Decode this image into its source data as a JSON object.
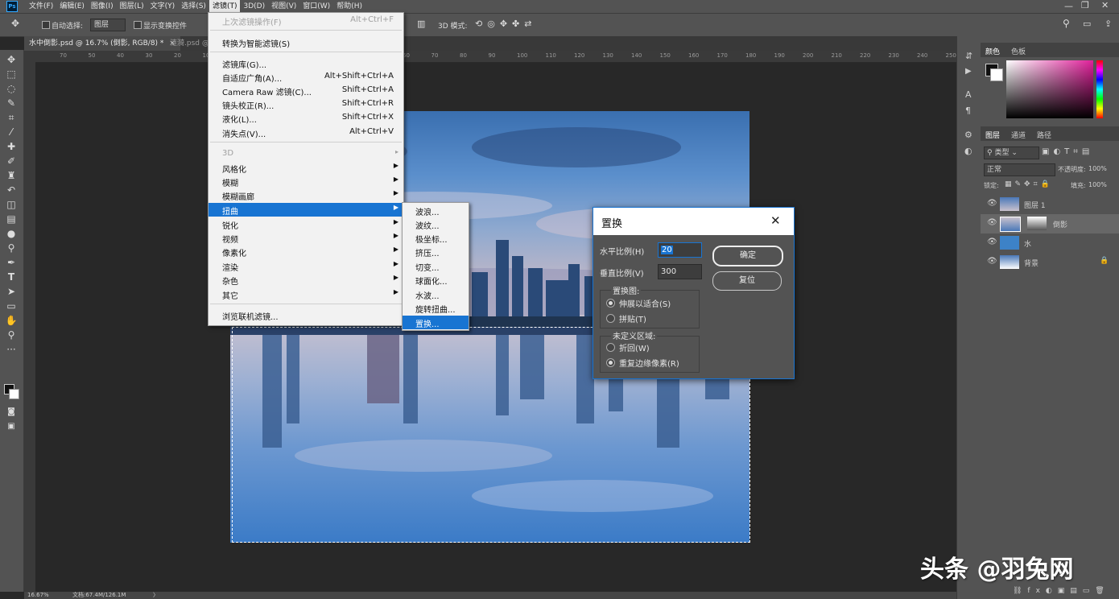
{
  "menubar": {
    "logo": "Ps",
    "items": [
      "文件(F)",
      "编辑(E)",
      "图像(I)",
      "图层(L)",
      "文字(Y)",
      "选择(S)",
      "滤镜(T)",
      "3D(D)",
      "视图(V)",
      "窗口(W)",
      "帮助(H)"
    ]
  },
  "options": {
    "auto_select": "自动选择:",
    "layer_select": "图层",
    "show_transform": "显示变换控件",
    "mode_3d": "3D 模式:"
  },
  "tabs": [
    {
      "label": "水中倒影.psd @ 16.7% (倒影, RGB/8) *",
      "close": "×"
    },
    {
      "label": "涟漪.psd @"
    }
  ],
  "ruler_ticks": [
    "70",
    "50",
    "40",
    "30",
    "20",
    "10",
    "0",
    "10",
    "20",
    "30",
    "40",
    "50",
    "60",
    "70",
    "80",
    "90",
    "100",
    "110",
    "120",
    "130",
    "140",
    "150",
    "160",
    "170",
    "180",
    "190",
    "200",
    "210",
    "220",
    "230",
    "240",
    "250"
  ],
  "status": {
    "zoom": "16.67%",
    "doc": "文档:67.4M/126.1M"
  },
  "filter_menu": {
    "items": [
      {
        "label": "上次滤镜操作(F)",
        "shortcut": "Alt+Ctrl+F",
        "disabled": true
      },
      {
        "label": "转换为智能滤镜(S)",
        "shortcut": ""
      },
      {
        "label": "滤镜库(G)...",
        "shortcut": ""
      },
      {
        "label": "自适应广角(A)...",
        "shortcut": "Alt+Shift+Ctrl+A"
      },
      {
        "label": "Camera Raw 滤镜(C)...",
        "shortcut": "Shift+Ctrl+A"
      },
      {
        "label": "镜头校正(R)...",
        "shortcut": "Shift+Ctrl+R"
      },
      {
        "label": "液化(L)...",
        "shortcut": "Shift+Ctrl+X"
      },
      {
        "label": "消失点(V)...",
        "shortcut": "Alt+Ctrl+V"
      },
      {
        "label": "3D",
        "disabled": true
      },
      {
        "label": "风格化"
      },
      {
        "label": "模糊"
      },
      {
        "label": "模糊画廊"
      },
      {
        "label": "扭曲"
      },
      {
        "label": "锐化"
      },
      {
        "label": "视频"
      },
      {
        "label": "像素化"
      },
      {
        "label": "渲染"
      },
      {
        "label": "杂色"
      },
      {
        "label": "其它"
      },
      {
        "label": "浏览联机滤镜..."
      }
    ]
  },
  "distort_submenu": [
    "波浪...",
    "波纹...",
    "极坐标...",
    "挤压...",
    "切变...",
    "球面化...",
    "水波...",
    "旋转扭曲...",
    "置换..."
  ],
  "dialog": {
    "title": "置换",
    "close": "✕",
    "h_scale_label": "水平比例(H)",
    "h_scale_value": "20",
    "v_scale_label": "垂直比例(V)",
    "v_scale_value": "300",
    "ok": "确定",
    "reset": "复位",
    "map_group": "置换图:",
    "stretch": "伸展以适合(S)",
    "tile": "拼贴(T)",
    "undef_group": "未定义区域:",
    "wrap": "折回(W)",
    "repeat": "重复边缘像素(R)"
  },
  "panels": {
    "color_tabs": [
      "颜色",
      "色板"
    ],
    "layer_tabs": [
      "图层",
      "通道",
      "路径"
    ],
    "kind": "类型",
    "blend": "正常",
    "opacity_label": "不透明度:",
    "opacity": "100%",
    "lock_label": "锁定:",
    "fill_label": "填充:",
    "fill": "100%",
    "layers": [
      "图层 1",
      "倒影",
      "水",
      "背景"
    ]
  },
  "watermark": "头条 @羽兔网"
}
